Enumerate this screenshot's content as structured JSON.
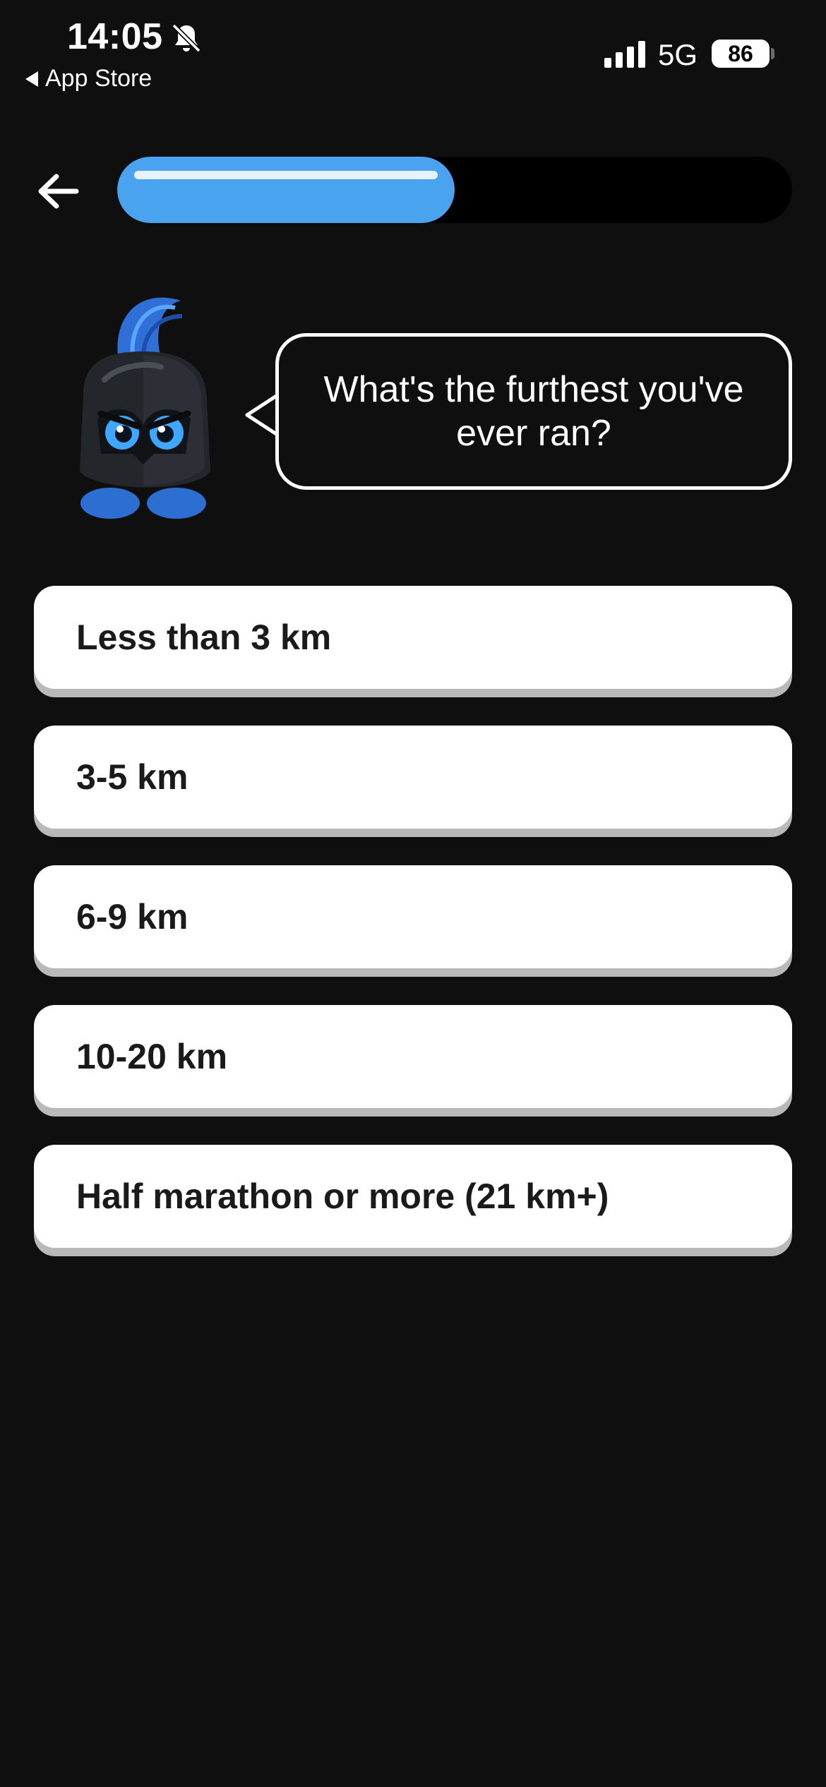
{
  "status_bar": {
    "time": "14:05",
    "back_app_label": "App Store",
    "network": "5G",
    "battery": "86",
    "icons": [
      "bell-slash-icon",
      "signal-bars-icon",
      "battery-icon"
    ]
  },
  "nav": {
    "back_icon": "arrow-left-icon",
    "progress_fraction": 0.5
  },
  "question": {
    "mascot": "spartan-helmet-mascot",
    "text": "What's the furthest you've ever ran?"
  },
  "options": [
    {
      "label": "Less than 3 km"
    },
    {
      "label": "3-5 km"
    },
    {
      "label": "6-9 km"
    },
    {
      "label": "10-20 km"
    },
    {
      "label": "Half marathon or more (21 km+)"
    }
  ],
  "colors": {
    "background": "#0f0f0f",
    "accent": "#4aa3ee",
    "option_bg": "#ffffff",
    "option_shadow": "#b9b9b9"
  }
}
